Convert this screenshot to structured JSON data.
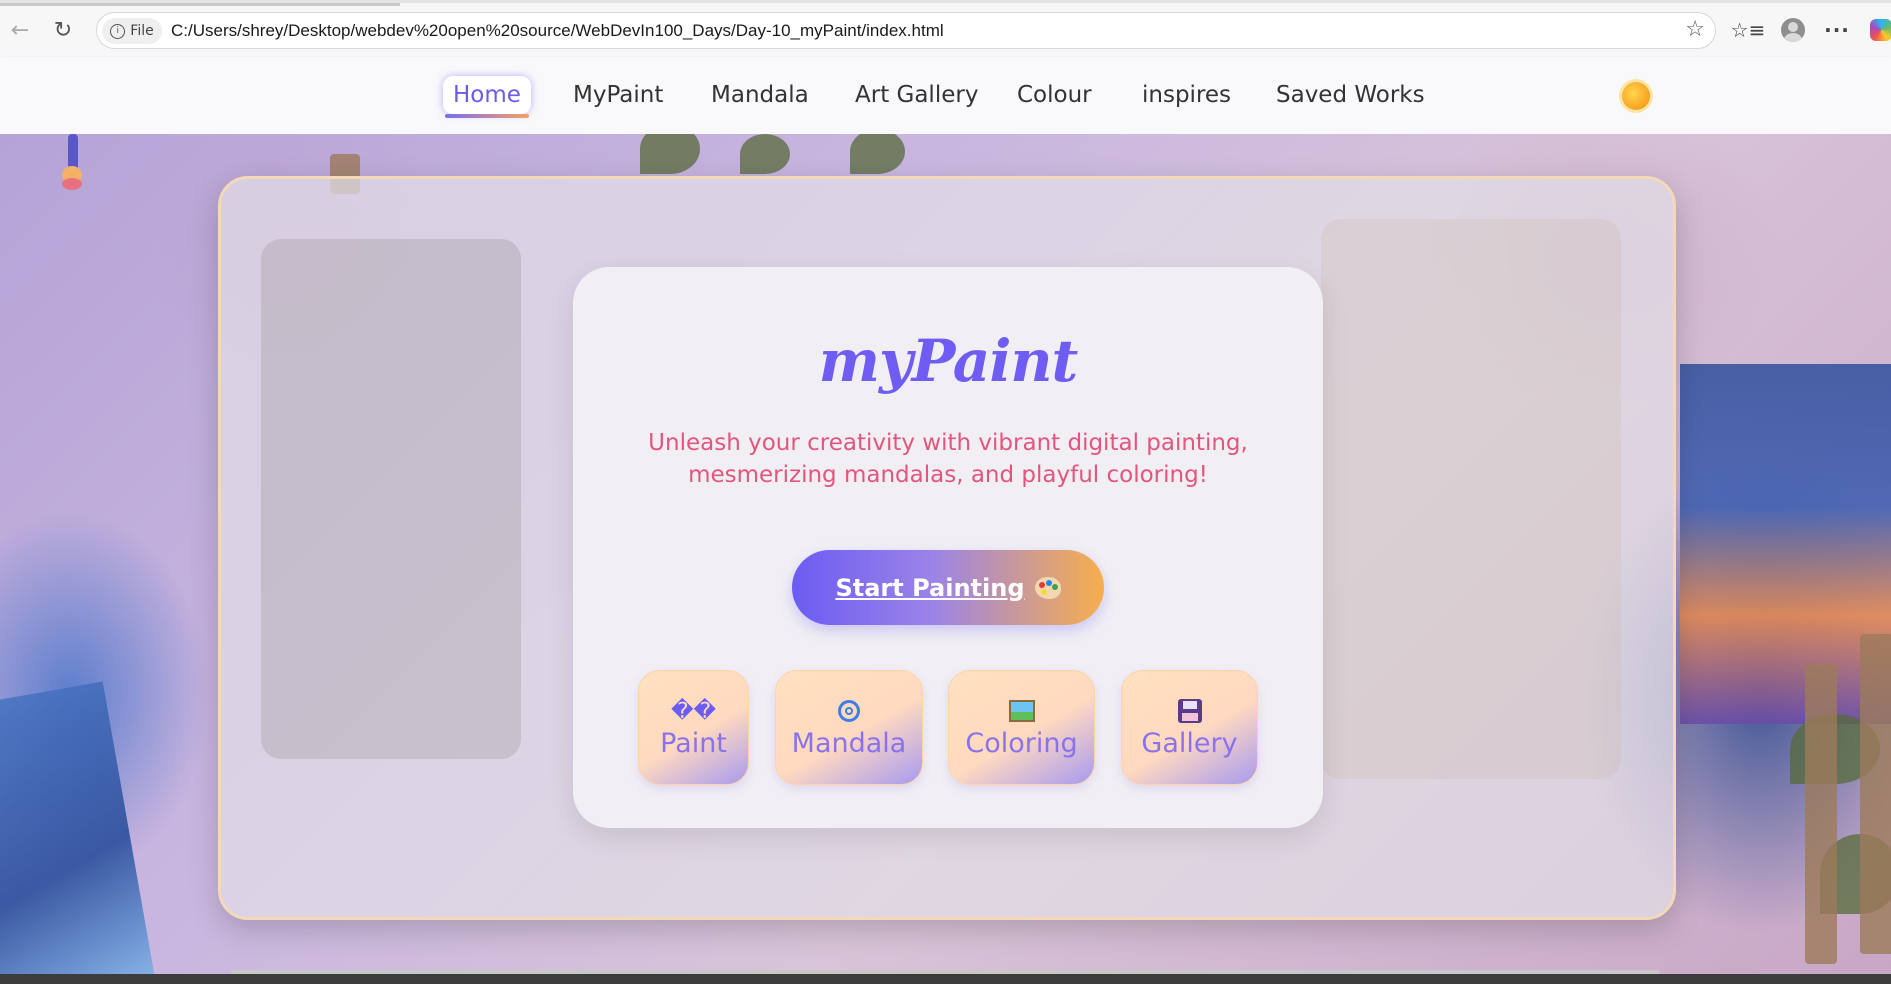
{
  "browser": {
    "file_label": "File",
    "url": "C:/Users/shrey/Desktop/webdev%20open%20source/WebDevIn100_Days/Day-10_myPaint/index.html"
  },
  "nav": {
    "items": [
      {
        "label": "Home"
      },
      {
        "label": "MyPaint"
      },
      {
        "label": "Mandala"
      },
      {
        "label": "Art Gallery"
      },
      {
        "label": "Colour"
      },
      {
        "label": "inspires"
      },
      {
        "label": "Saved Works"
      }
    ],
    "active_index": 0
  },
  "hero": {
    "title": "myPaint",
    "subtitle": "Unleash your creativity with vibrant digital painting, mesmerizing mandalas, and playful coloring!",
    "cta_label": "Start Painting"
  },
  "tiles": [
    {
      "label": "Paint",
      "icon_text": "��",
      "icon": "broken-glyph-icon"
    },
    {
      "label": "Mandala",
      "icon": "spiral-icon"
    },
    {
      "label": "Coloring",
      "icon": "framed-picture-icon"
    },
    {
      "label": "Gallery",
      "icon": "floppy-disk-icon"
    }
  ],
  "colors": {
    "accent": "#6b5cf2",
    "subtitle": "#e2567d",
    "cta_gradient_end": "#f7ae4c"
  }
}
